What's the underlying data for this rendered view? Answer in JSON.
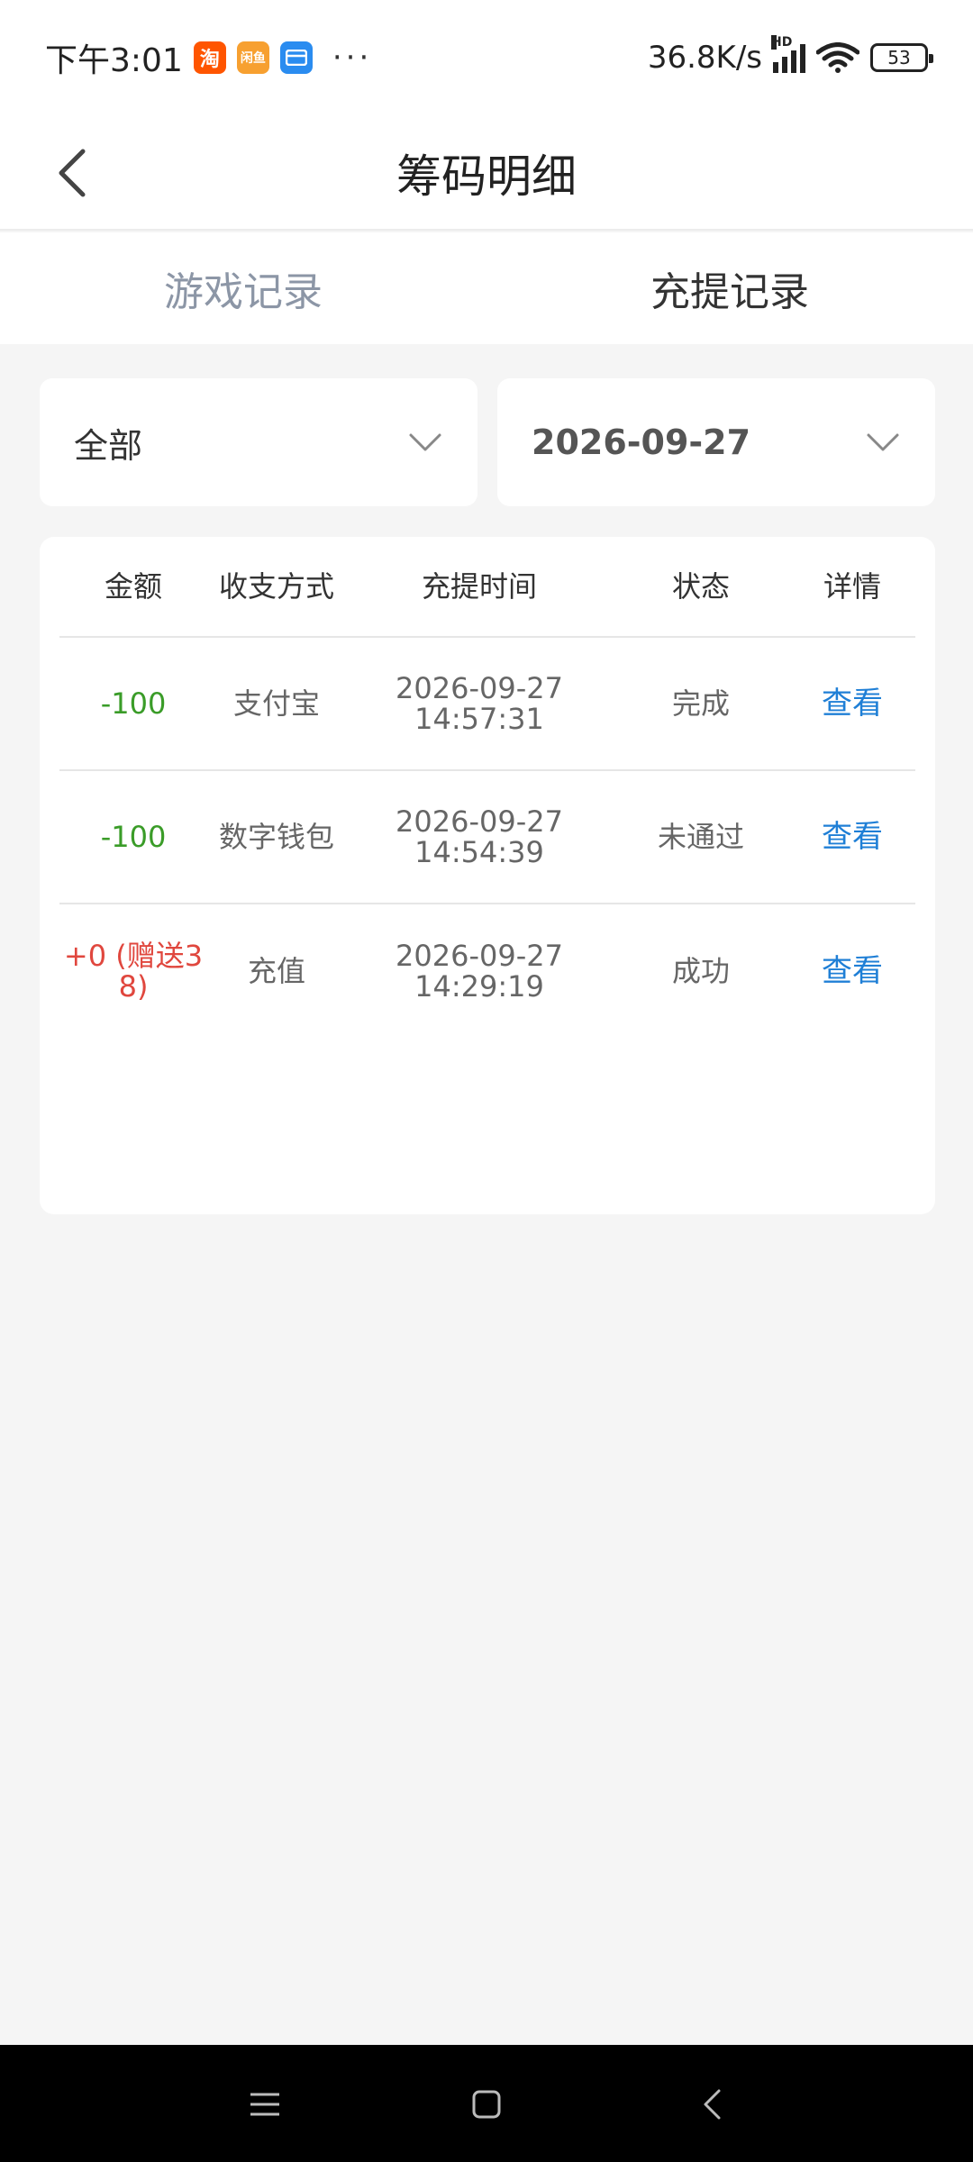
{
  "status_bar": {
    "time": "下午3:01",
    "apps": [
      "淘",
      "闲鱼",
      ""
    ],
    "dots": "···",
    "net_speed": "36.8K/s",
    "signal_label": "HD",
    "battery": "53"
  },
  "header": {
    "title": "筹码明细"
  },
  "tabs": [
    {
      "label": "游戏记录",
      "active": false
    },
    {
      "label": "充提记录",
      "active": true
    }
  ],
  "filters": {
    "type_value": "全部",
    "date_value": "2026-09-27"
  },
  "table": {
    "columns": [
      "金额",
      "收支方式",
      "充提时间",
      "状态",
      "详情"
    ],
    "rows": [
      {
        "amount": "-100",
        "method": "支付宝",
        "date": "2026-09-27",
        "time": "14:57:31",
        "status": "完成",
        "action": "查看"
      },
      {
        "amount": "-100",
        "method": "数字钱包",
        "date": "2026-09-27",
        "time": "14:54:39",
        "status": "未通过",
        "action": "查看"
      },
      {
        "amount_line1": "+0 (赠送3",
        "amount_line2": "8)",
        "method": "充值",
        "date": "2026-09-27",
        "time": "14:29:19",
        "status": "成功",
        "action": "查看"
      }
    ]
  },
  "colors": {
    "negative": "#3a9c28",
    "positive": "#e0473e",
    "link": "#1f7fd6"
  }
}
